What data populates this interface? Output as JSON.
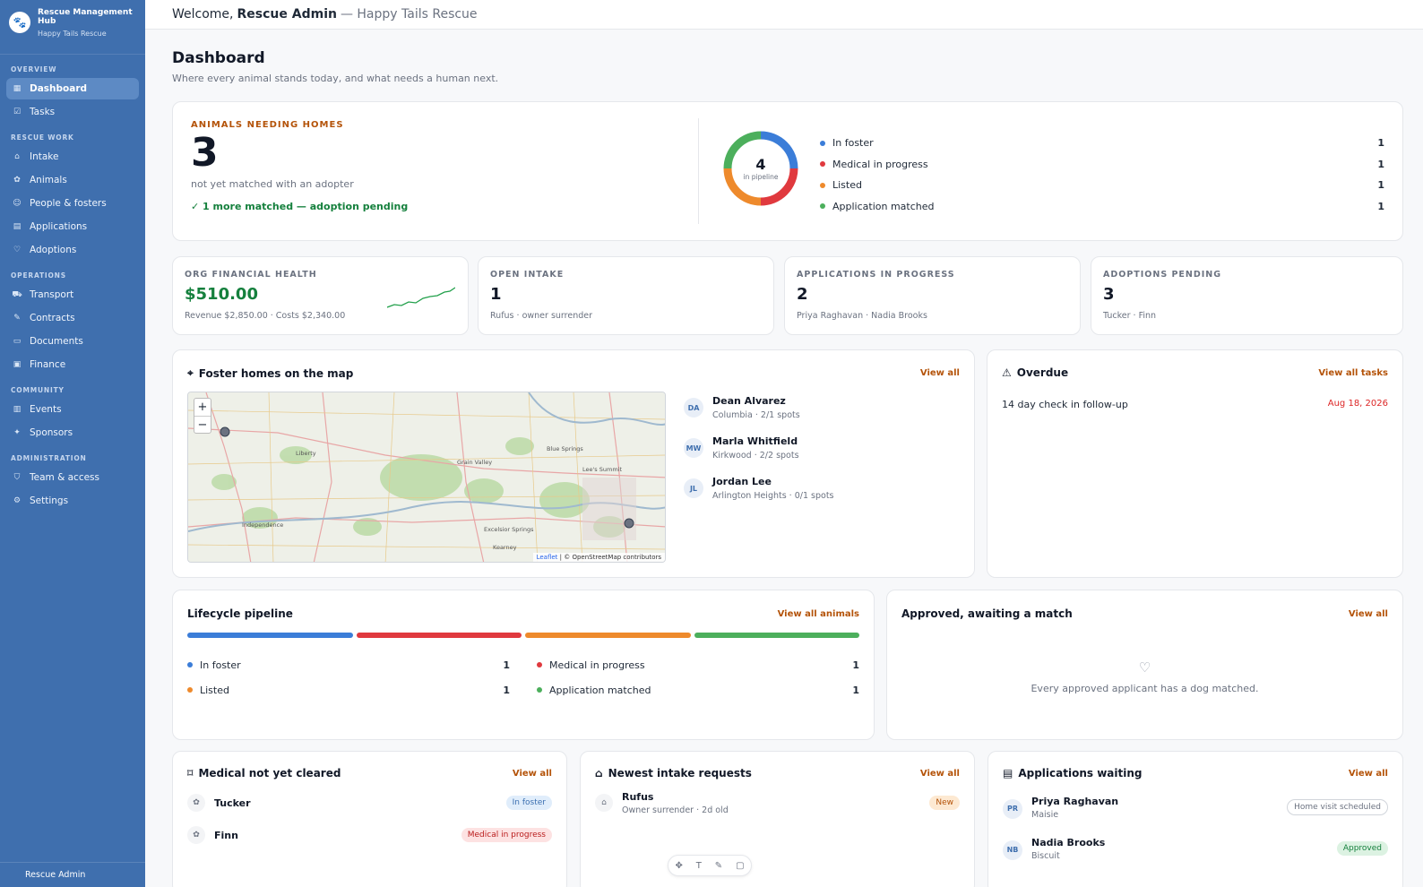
{
  "brand": {
    "name": "Rescue Management Hub",
    "org": "Happy Tails Rescue"
  },
  "sidebar": {
    "sections": [
      {
        "label": "OVERVIEW",
        "items": [
          {
            "label": "Dashboard",
            "icon": "grid-icon",
            "active": true
          },
          {
            "label": "Tasks",
            "icon": "checklist-icon"
          }
        ]
      },
      {
        "label": "RESCUE WORK",
        "items": [
          {
            "label": "Intake",
            "icon": "inbox-icon"
          },
          {
            "label": "Animals",
            "icon": "paw-icon"
          },
          {
            "label": "People & fosters",
            "icon": "people-icon"
          },
          {
            "label": "Applications",
            "icon": "clipboard-icon"
          },
          {
            "label": "Adoptions",
            "icon": "heart-icon"
          }
        ]
      },
      {
        "label": "OPERATIONS",
        "items": [
          {
            "label": "Transport",
            "icon": "truck-icon"
          },
          {
            "label": "Contracts",
            "icon": "contract-icon"
          },
          {
            "label": "Documents",
            "icon": "document-icon"
          },
          {
            "label": "Finance",
            "icon": "finance-icon"
          }
        ]
      },
      {
        "label": "COMMUNITY",
        "items": [
          {
            "label": "Events",
            "icon": "calendar-icon"
          },
          {
            "label": "Sponsors",
            "icon": "sponsor-icon"
          }
        ]
      },
      {
        "label": "ADMINISTRATION",
        "items": [
          {
            "label": "Team & access",
            "icon": "shield-icon"
          },
          {
            "label": "Settings",
            "icon": "gear-icon"
          }
        ]
      }
    ],
    "footer_user": "Rescue Admin"
  },
  "header": {
    "welcome": "Welcome,",
    "user": "Rescue Admin",
    "org": "— Happy Tails Rescue"
  },
  "page": {
    "title": "Dashboard",
    "subtitle": "Where every animal stands today, and what needs a human next."
  },
  "hero": {
    "eyebrow": "ANIMALS NEEDING HOMES",
    "count": "3",
    "note": "not yet matched with an adopter",
    "matched": "1 more matched — adoption pending",
    "donut_total": "4",
    "donut_label": "in pipeline",
    "legend": [
      {
        "label": "In foster",
        "count": "1",
        "color": "#3b7dd8"
      },
      {
        "label": "Medical in progress",
        "count": "1",
        "color": "#e0393e"
      },
      {
        "label": "Listed",
        "count": "1",
        "color": "#ee8a2c"
      },
      {
        "label": "Application matched",
        "count": "1",
        "color": "#4caf5c"
      }
    ]
  },
  "stats": [
    {
      "label": "ORG FINANCIAL HEALTH",
      "value": "$510.00",
      "sub": "Revenue $2,850.00 · Costs $2,340.00"
    },
    {
      "label": "OPEN INTAKE",
      "value": "1",
      "sub": "Rufus · owner surrender"
    },
    {
      "label": "APPLICATIONS IN PROGRESS",
      "value": "2",
      "sub": "Priya Raghavan · Nadia Brooks"
    },
    {
      "label": "ADOPTIONS PENDING",
      "value": "3",
      "sub": "Tucker · Finn"
    }
  ],
  "map_card": {
    "title": "Foster homes on the map",
    "link": "View all",
    "zoom_in": "+",
    "zoom_out": "−",
    "attribution_leaflet": "Leaflet",
    "attribution_rest": "| © OpenStreetMap contributors",
    "place_labels": [
      "Liberty",
      "Grain Valley",
      "Blue Springs",
      "Lee's Summit",
      "Independence",
      "Excelsior Springs",
      "Kearney"
    ],
    "fosters": [
      {
        "initials": "DA",
        "name": "Dean Alvarez",
        "meta": "Columbia · 2/1 spots"
      },
      {
        "initials": "MW",
        "name": "Marla Whitfield",
        "meta": "Kirkwood · 2/2 spots"
      },
      {
        "initials": "JL",
        "name": "Jordan Lee",
        "meta": "Arlington Heights · 0/1 spots"
      }
    ]
  },
  "overdue": {
    "title": "Overdue",
    "link": "View all tasks",
    "items": [
      {
        "task": "14 day check in follow-up",
        "date": "Aug 18, 2026"
      }
    ]
  },
  "lifecycle": {
    "title": "Lifecycle pipeline",
    "link": "View all animals",
    "rows": [
      {
        "label": "In foster",
        "count": "1",
        "color": "#3b7dd8"
      },
      {
        "label": "Medical in progress",
        "count": "1",
        "color": "#e0393e"
      },
      {
        "label": "Listed",
        "count": "1",
        "color": "#ee8a2c"
      },
      {
        "label": "Application matched",
        "count": "1",
        "color": "#4caf5c"
      }
    ]
  },
  "approved": {
    "title": "Approved, awaiting a match",
    "link": "View all",
    "empty": "Every approved applicant has a dog matched."
  },
  "medical": {
    "title": "Medical not yet cleared",
    "link": "View all",
    "items": [
      {
        "name": "Tucker",
        "status": "In foster"
      },
      {
        "name": "Finn",
        "status": "Medical in progress"
      }
    ]
  },
  "intake": {
    "title": "Newest intake requests",
    "link": "View all",
    "items": [
      {
        "name": "Rufus",
        "meta": "Owner surrender · 2d old",
        "status": "New"
      }
    ]
  },
  "applications": {
    "title": "Applications waiting",
    "link": "View all",
    "items": [
      {
        "initials": "PR",
        "name": "Priya Raghavan",
        "pet": "Maisie",
        "status": "Home visit scheduled"
      },
      {
        "initials": "NB",
        "name": "Nadia Brooks",
        "pet": "Biscuit",
        "status": "Approved"
      }
    ]
  },
  "colors": {
    "sidebar": "#3f6fae",
    "accent": "#b45309",
    "positive": "#15803d",
    "danger": "#dc2626"
  }
}
